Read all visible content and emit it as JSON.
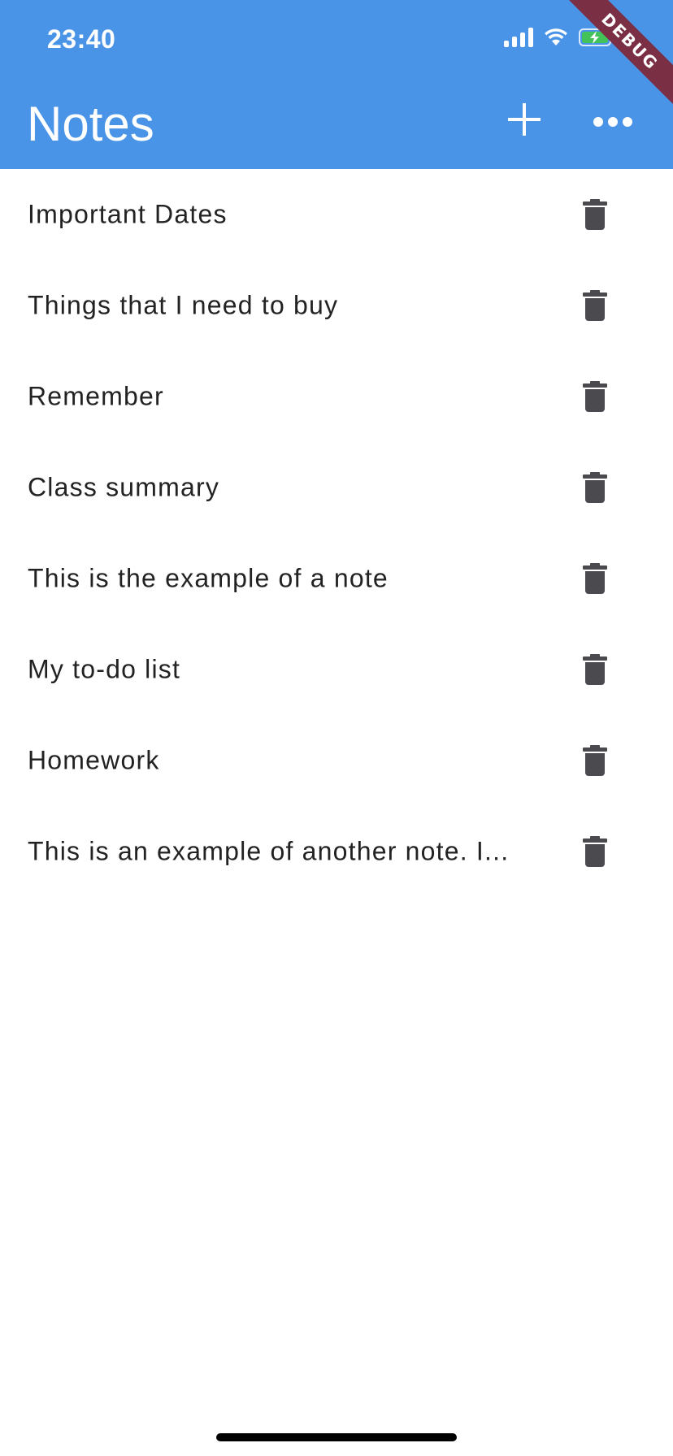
{
  "status_bar": {
    "time": "23:40",
    "icons": [
      "signal-icon",
      "wifi-icon",
      "battery-charging-icon"
    ]
  },
  "debug_banner": "DEBUG",
  "app_bar": {
    "title": "Notes",
    "actions": [
      "add-icon",
      "more-icon"
    ]
  },
  "notes": [
    {
      "title": "Important Dates"
    },
    {
      "title": "Things that I need to buy"
    },
    {
      "title": "Remember"
    },
    {
      "title": "Class summary"
    },
    {
      "title": "This is the example of a note"
    },
    {
      "title": "My to-do list"
    },
    {
      "title": "Homework"
    },
    {
      "title": "This is an example of another note. I..."
    }
  ],
  "colors": {
    "app_bar": "#4a94e8",
    "debug_banner": "#7a2f45",
    "text": "#222222",
    "trash_icon": "#4a4a4f",
    "battery_charging": "#43c25a"
  }
}
